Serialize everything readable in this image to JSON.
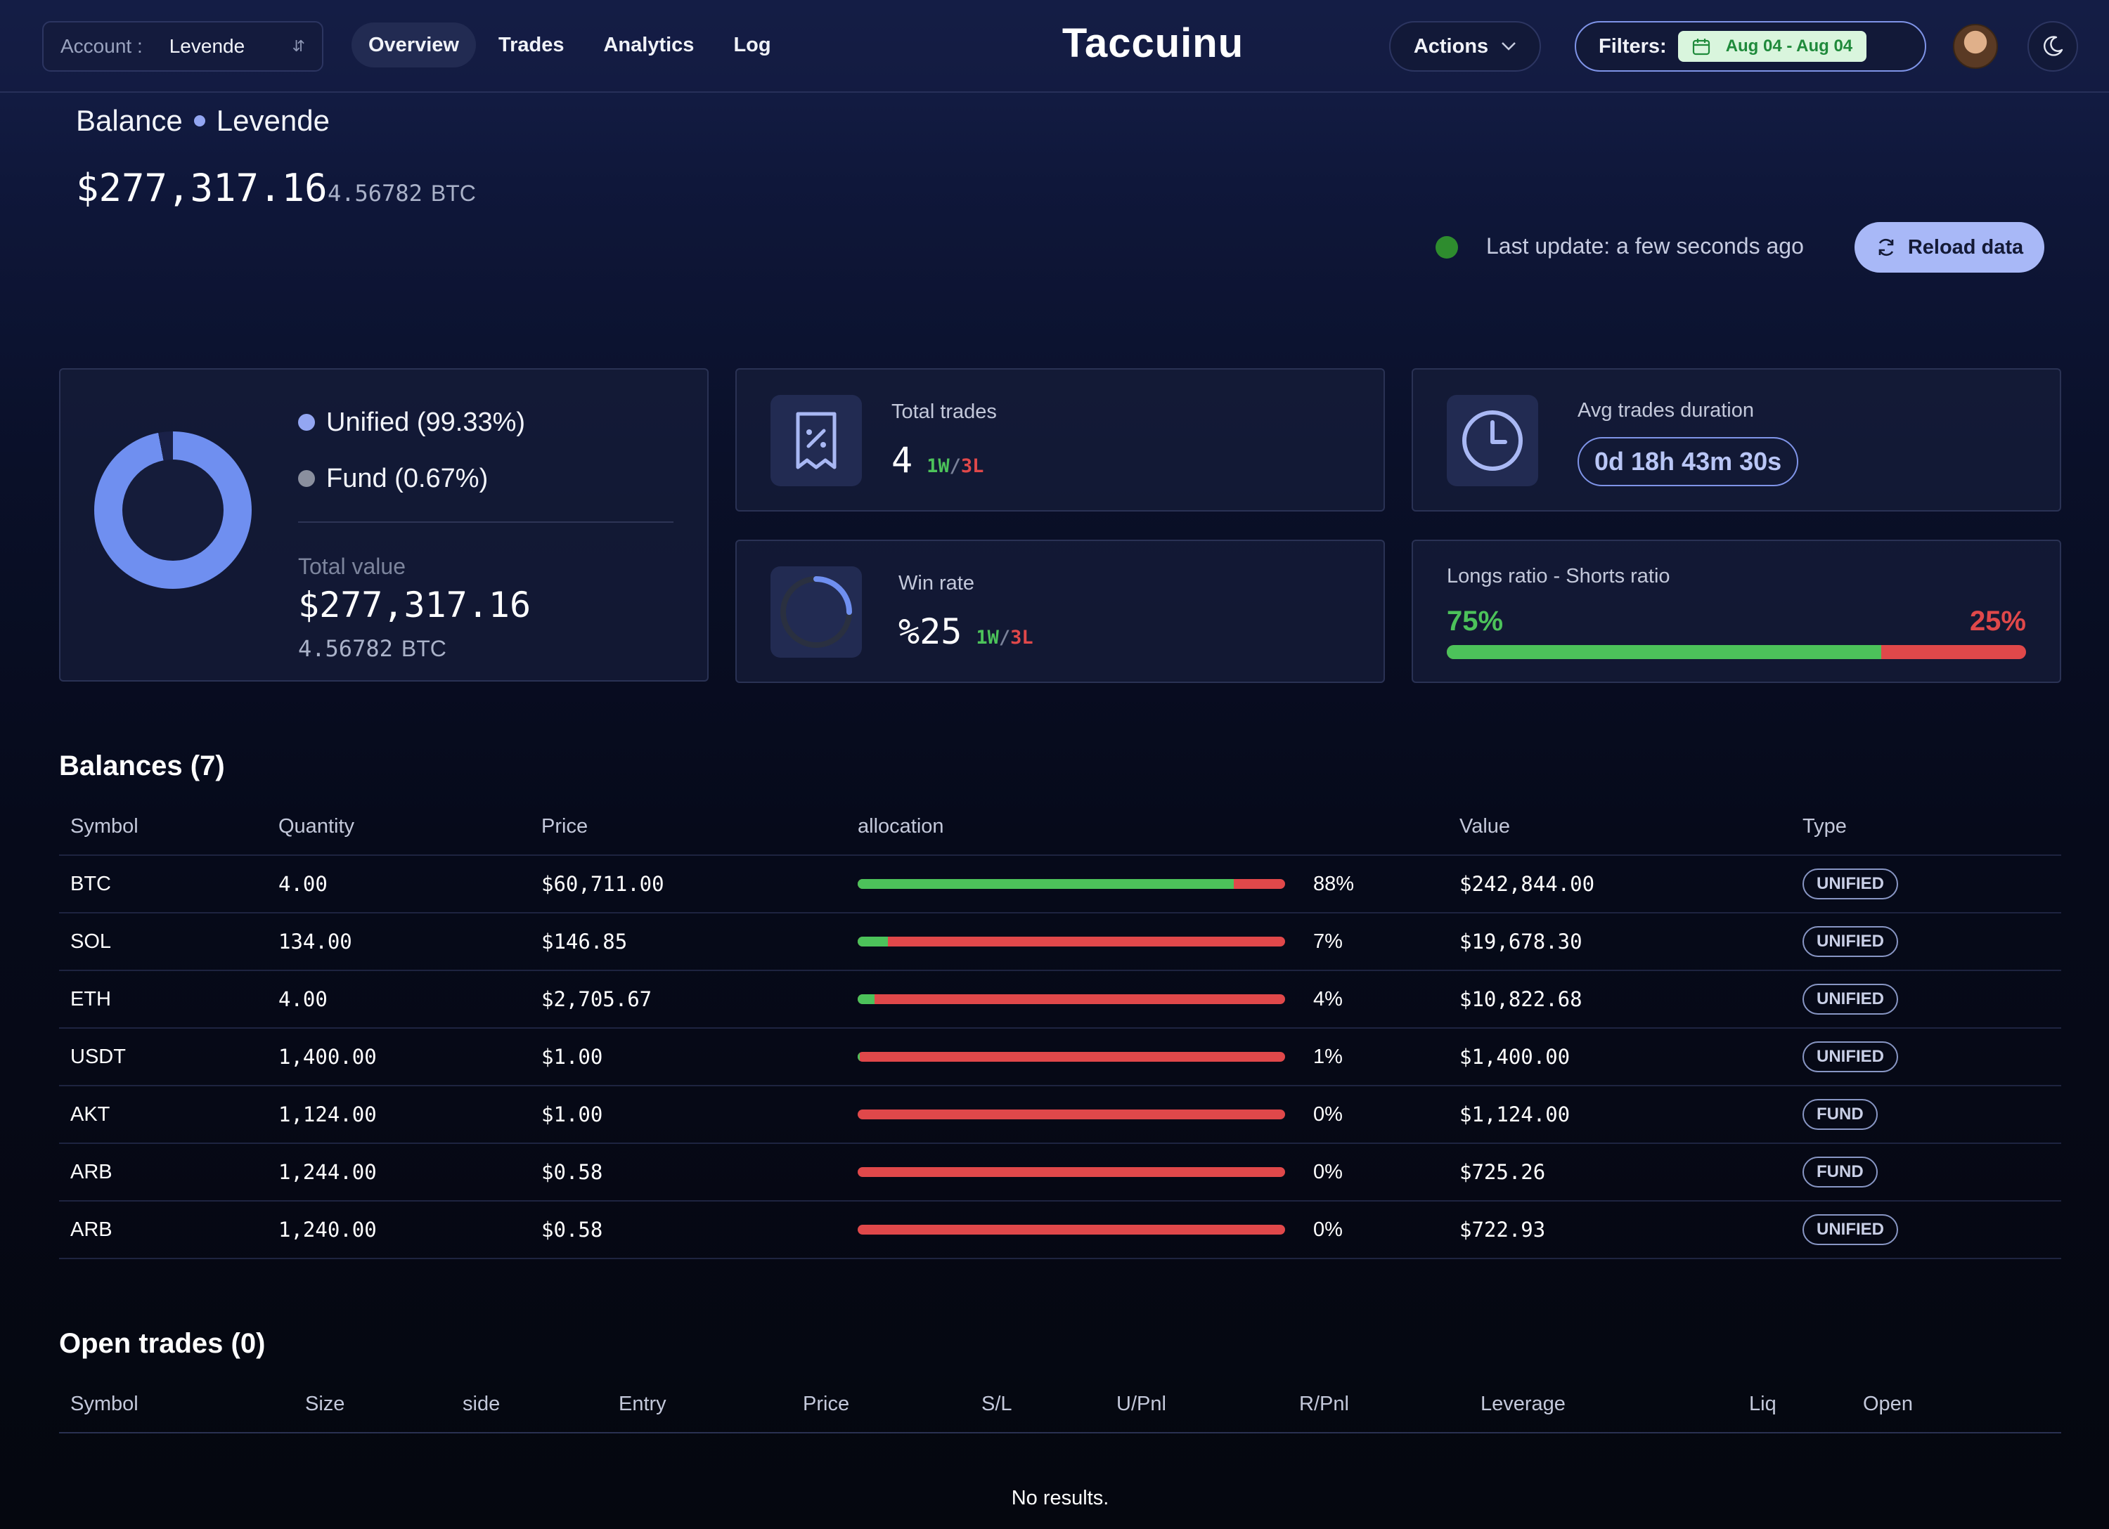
{
  "header": {
    "account_label": "Account :",
    "account_value": "Levende",
    "nav": [
      "Overview",
      "Trades",
      "Analytics",
      "Log"
    ],
    "active_tab": "Overview",
    "brand": "Taccuinu",
    "actions_label": "Actions",
    "filters_label": "Filters:",
    "date_range": "Aug 04 - Aug 04"
  },
  "balance": {
    "title": "Balance",
    "account": "Levende",
    "amount": "$277,317.16",
    "btc_value": "4.56782",
    "btc_unit": "BTC",
    "last_update": "Last update: a few seconds ago",
    "reload_label": "Reload data",
    "status_color": "#2e8c2e"
  },
  "distribution": {
    "legend": [
      {
        "label": "Unified (99.33%)",
        "color": "#93a6f2"
      },
      {
        "label": "Fund (0.67%)",
        "color": "#8a8f9e"
      }
    ],
    "total_label": "Total value",
    "total_amount": "$277,317.16",
    "total_btc": "4.56782",
    "total_btc_unit": "BTC"
  },
  "stats": {
    "total_trades_label": "Total trades",
    "total_trades_value": "4",
    "total_trades_w": "1W",
    "total_trades_l": "3L",
    "avg_duration_label": "Avg trades duration",
    "avg_duration_value": "0d 18h 43m 30s",
    "win_rate_label": "Win rate",
    "win_rate_value": "%25",
    "win_rate_w": "1W",
    "win_rate_l": "3L",
    "ratio_label": "Longs ratio - Shorts ratio",
    "longs_pct": "75%",
    "shorts_pct": "25%",
    "longs_fraction": 0.75,
    "win_rate_fraction": 0.25
  },
  "balances": {
    "title": "Balances (7)",
    "columns": [
      "Symbol",
      "Quantity",
      "Price",
      "allocation",
      "Value",
      "Type"
    ],
    "rows": [
      {
        "symbol": "BTC",
        "quantity": "4.00",
        "price": "$60,711.00",
        "allocation": "88%",
        "alloc_fraction": 0.88,
        "value": "$242,844.00",
        "type": "UNIFIED"
      },
      {
        "symbol": "SOL",
        "quantity": "134.00",
        "price": "$146.85",
        "allocation": "7%",
        "alloc_fraction": 0.07,
        "value": "$19,678.30",
        "type": "UNIFIED"
      },
      {
        "symbol": "ETH",
        "quantity": "4.00",
        "price": "$2,705.67",
        "allocation": "4%",
        "alloc_fraction": 0.04,
        "value": "$10,822.68",
        "type": "UNIFIED"
      },
      {
        "symbol": "USDT",
        "quantity": "1,400.00",
        "price": "$1.00",
        "allocation": "1%",
        "alloc_fraction": 0.005,
        "value": "$1,400.00",
        "type": "UNIFIED"
      },
      {
        "symbol": "AKT",
        "quantity": "1,124.00",
        "price": "$1.00",
        "allocation": "0%",
        "alloc_fraction": 0.0,
        "value": "$1,124.00",
        "type": "FUND"
      },
      {
        "symbol": "ARB",
        "quantity": "1,244.00",
        "price": "$0.58",
        "allocation": "0%",
        "alloc_fraction": 0.0,
        "value": "$725.26",
        "type": "FUND"
      },
      {
        "symbol": "ARB",
        "quantity": "1,240.00",
        "price": "$0.58",
        "allocation": "0%",
        "alloc_fraction": 0.0,
        "value": "$722.93",
        "type": "UNIFIED"
      }
    ]
  },
  "open_trades": {
    "title": "Open trades (0)",
    "columns": [
      "Symbol",
      "Size",
      "side",
      "Entry",
      "Price",
      "S/L",
      "U/Pnl",
      "R/Pnl",
      "Leverage",
      "Liq",
      "Open"
    ],
    "empty_text": "No results."
  }
}
